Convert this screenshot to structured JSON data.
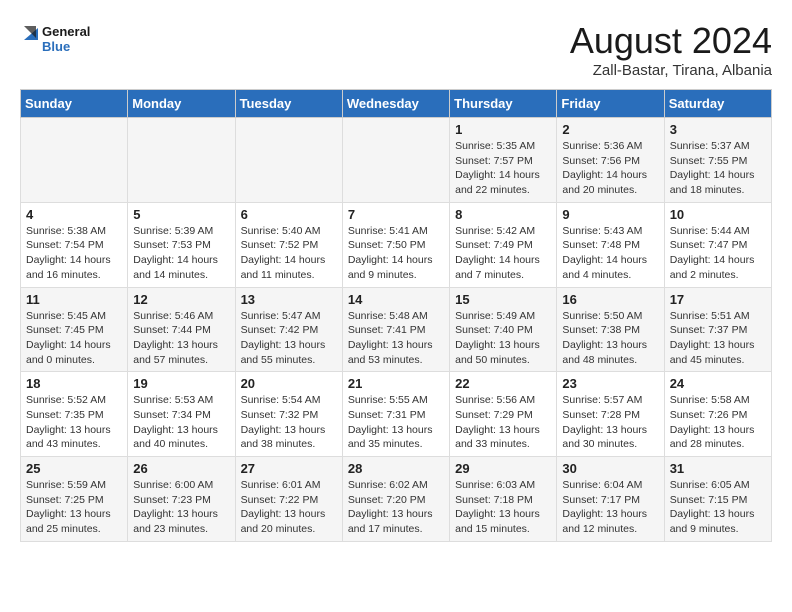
{
  "logo": {
    "line1": "General",
    "line2": "Blue"
  },
  "title": "August 2024",
  "subtitle": "Zall-Bastar, Tirana, Albania",
  "weekdays": [
    "Sunday",
    "Monday",
    "Tuesday",
    "Wednesday",
    "Thursday",
    "Friday",
    "Saturday"
  ],
  "weeks": [
    [
      {
        "day": "",
        "info": ""
      },
      {
        "day": "",
        "info": ""
      },
      {
        "day": "",
        "info": ""
      },
      {
        "day": "",
        "info": ""
      },
      {
        "day": "1",
        "info": "Sunrise: 5:35 AM\nSunset: 7:57 PM\nDaylight: 14 hours\nand 22 minutes."
      },
      {
        "day": "2",
        "info": "Sunrise: 5:36 AM\nSunset: 7:56 PM\nDaylight: 14 hours\nand 20 minutes."
      },
      {
        "day": "3",
        "info": "Sunrise: 5:37 AM\nSunset: 7:55 PM\nDaylight: 14 hours\nand 18 minutes."
      }
    ],
    [
      {
        "day": "4",
        "info": "Sunrise: 5:38 AM\nSunset: 7:54 PM\nDaylight: 14 hours\nand 16 minutes."
      },
      {
        "day": "5",
        "info": "Sunrise: 5:39 AM\nSunset: 7:53 PM\nDaylight: 14 hours\nand 14 minutes."
      },
      {
        "day": "6",
        "info": "Sunrise: 5:40 AM\nSunset: 7:52 PM\nDaylight: 14 hours\nand 11 minutes."
      },
      {
        "day": "7",
        "info": "Sunrise: 5:41 AM\nSunset: 7:50 PM\nDaylight: 14 hours\nand 9 minutes."
      },
      {
        "day": "8",
        "info": "Sunrise: 5:42 AM\nSunset: 7:49 PM\nDaylight: 14 hours\nand 7 minutes."
      },
      {
        "day": "9",
        "info": "Sunrise: 5:43 AM\nSunset: 7:48 PM\nDaylight: 14 hours\nand 4 minutes."
      },
      {
        "day": "10",
        "info": "Sunrise: 5:44 AM\nSunset: 7:47 PM\nDaylight: 14 hours\nand 2 minutes."
      }
    ],
    [
      {
        "day": "11",
        "info": "Sunrise: 5:45 AM\nSunset: 7:45 PM\nDaylight: 14 hours\nand 0 minutes."
      },
      {
        "day": "12",
        "info": "Sunrise: 5:46 AM\nSunset: 7:44 PM\nDaylight: 13 hours\nand 57 minutes."
      },
      {
        "day": "13",
        "info": "Sunrise: 5:47 AM\nSunset: 7:42 PM\nDaylight: 13 hours\nand 55 minutes."
      },
      {
        "day": "14",
        "info": "Sunrise: 5:48 AM\nSunset: 7:41 PM\nDaylight: 13 hours\nand 53 minutes."
      },
      {
        "day": "15",
        "info": "Sunrise: 5:49 AM\nSunset: 7:40 PM\nDaylight: 13 hours\nand 50 minutes."
      },
      {
        "day": "16",
        "info": "Sunrise: 5:50 AM\nSunset: 7:38 PM\nDaylight: 13 hours\nand 48 minutes."
      },
      {
        "day": "17",
        "info": "Sunrise: 5:51 AM\nSunset: 7:37 PM\nDaylight: 13 hours\nand 45 minutes."
      }
    ],
    [
      {
        "day": "18",
        "info": "Sunrise: 5:52 AM\nSunset: 7:35 PM\nDaylight: 13 hours\nand 43 minutes."
      },
      {
        "day": "19",
        "info": "Sunrise: 5:53 AM\nSunset: 7:34 PM\nDaylight: 13 hours\nand 40 minutes."
      },
      {
        "day": "20",
        "info": "Sunrise: 5:54 AM\nSunset: 7:32 PM\nDaylight: 13 hours\nand 38 minutes."
      },
      {
        "day": "21",
        "info": "Sunrise: 5:55 AM\nSunset: 7:31 PM\nDaylight: 13 hours\nand 35 minutes."
      },
      {
        "day": "22",
        "info": "Sunrise: 5:56 AM\nSunset: 7:29 PM\nDaylight: 13 hours\nand 33 minutes."
      },
      {
        "day": "23",
        "info": "Sunrise: 5:57 AM\nSunset: 7:28 PM\nDaylight: 13 hours\nand 30 minutes."
      },
      {
        "day": "24",
        "info": "Sunrise: 5:58 AM\nSunset: 7:26 PM\nDaylight: 13 hours\nand 28 minutes."
      }
    ],
    [
      {
        "day": "25",
        "info": "Sunrise: 5:59 AM\nSunset: 7:25 PM\nDaylight: 13 hours\nand 25 minutes."
      },
      {
        "day": "26",
        "info": "Sunrise: 6:00 AM\nSunset: 7:23 PM\nDaylight: 13 hours\nand 23 minutes."
      },
      {
        "day": "27",
        "info": "Sunrise: 6:01 AM\nSunset: 7:22 PM\nDaylight: 13 hours\nand 20 minutes."
      },
      {
        "day": "28",
        "info": "Sunrise: 6:02 AM\nSunset: 7:20 PM\nDaylight: 13 hours\nand 17 minutes."
      },
      {
        "day": "29",
        "info": "Sunrise: 6:03 AM\nSunset: 7:18 PM\nDaylight: 13 hours\nand 15 minutes."
      },
      {
        "day": "30",
        "info": "Sunrise: 6:04 AM\nSunset: 7:17 PM\nDaylight: 13 hours\nand 12 minutes."
      },
      {
        "day": "31",
        "info": "Sunrise: 6:05 AM\nSunset: 7:15 PM\nDaylight: 13 hours\nand 9 minutes."
      }
    ]
  ]
}
